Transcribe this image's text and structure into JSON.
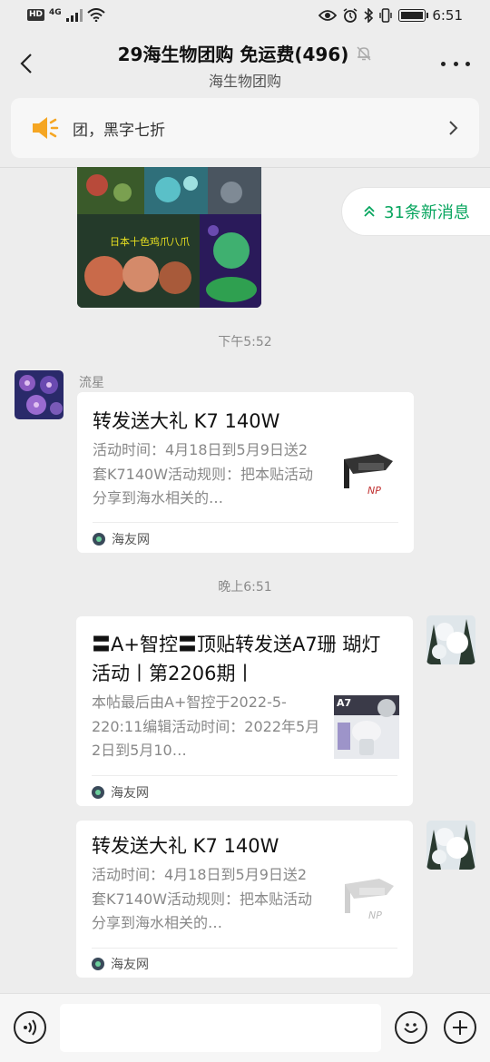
{
  "status_bar": {
    "hd": "HD",
    "network": "4G",
    "time": "6:51"
  },
  "header": {
    "title": "29海生物团购  免运费(496)",
    "subtitle": "海生物团购"
  },
  "notice": {
    "text": "团，黑字七折"
  },
  "new_messages": {
    "label": "31条新消息"
  },
  "timestamps": {
    "t1": "下午5:52",
    "t2": "晚上6:51"
  },
  "messages": [
    {
      "sender": "流星",
      "title": "转发送大礼 K7 140W",
      "desc": "活动时间：4月18日到5月9日送2套K7140W活动规则：把本贴活动分享到海水相关的…",
      "source": "海友网"
    },
    {
      "title": "〓A+智控〓顶贴转发送A7珊 瑚灯活动丨第2206期丨",
      "desc": "本帖最后由A+智控于2022-5-220:11编辑活动时间：2022年5月2日到5月10…",
      "source": "海友网",
      "thumb_label": "A7"
    },
    {
      "title": "转发送大礼 K7 140W",
      "desc": "活动时间：4月18日到5月9日送2套K7140W活动规则：把本贴活动分享到海水相关的…",
      "source": "海友网"
    }
  ],
  "coral_image": {
    "caption": "日本十色鸡爪八爪"
  },
  "colors": {
    "accent_green": "#07a55e",
    "background": "#ededed",
    "speaker_orange": "#f5a623"
  },
  "icons": [
    "back-icon",
    "bell-muted-icon",
    "more-icon",
    "speaker-icon",
    "chevron-right-icon",
    "double-chevron-up-icon",
    "voice-icon",
    "emoji-icon",
    "plus-icon"
  ]
}
